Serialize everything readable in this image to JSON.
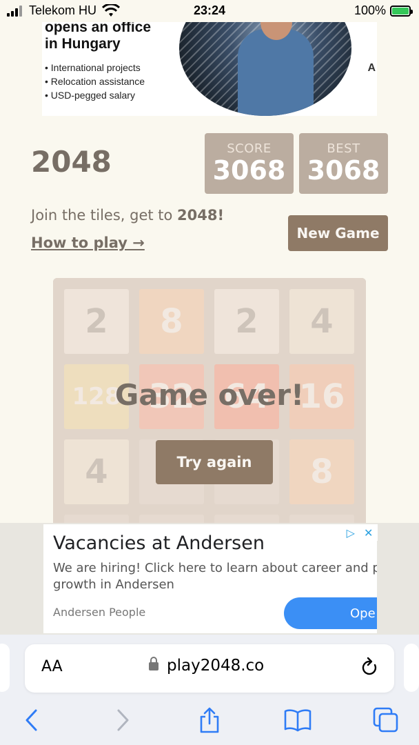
{
  "status_bar": {
    "carrier": "Telekom HU",
    "time": "23:24",
    "battery": "100%"
  },
  "ad_top": {
    "headline_line1": "opens an office",
    "headline_line2": "in Hungary",
    "bullets": [
      "International projects",
      "Relocation assistance",
      "USD-pegged salary"
    ],
    "side_letter": "A"
  },
  "game": {
    "title": "2048",
    "score_label": "SCORE",
    "score_value": "3068",
    "best_label": "BEST",
    "best_value": "3068",
    "intro_prefix": "Join the tiles, get to ",
    "intro_bold": "2048!",
    "how_to_play": "How to play →",
    "new_game": "New Game",
    "game_over": "Game over!",
    "try_again": "Try again",
    "tiles": [
      [
        "2",
        "8",
        "2",
        "4"
      ],
      [
        "128",
        "32",
        "64",
        "16"
      ],
      [
        "4",
        "",
        "",
        "8"
      ],
      [
        "",
        "",
        "",
        ""
      ]
    ]
  },
  "ad_bottom": {
    "headline": "Vacancies at Andersen",
    "body": "We are hiring! Click here to learn about career and p growth in Andersen",
    "source": "Andersen People",
    "open_label": "Ope"
  },
  "browser": {
    "text_size": "AA",
    "url": "play2048.co"
  }
}
